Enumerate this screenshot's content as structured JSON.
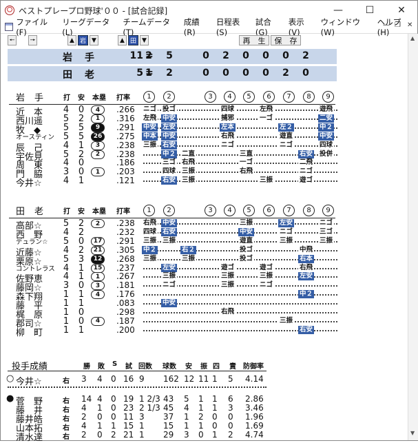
{
  "window": {
    "title": "ベストプレープロ野球'００ - [試合記録]"
  },
  "menu": [
    "ファイル(F)",
    "リーグデータ(L)",
    "チームデータ(T)",
    "成績(R)",
    "日程表(S)",
    "試合(G)",
    "表示(V)",
    "ウィンドウ(W)",
    "ヘルプ(H)"
  ],
  "toolbar": {
    "team1": "岩",
    "team2": "田",
    "play": "再　生",
    "save": "保　存"
  },
  "innings": [
    "1",
    "2",
    "3",
    "4",
    "5",
    "6",
    "7",
    "8",
    "9"
  ],
  "scoreboard": [
    {
      "team": "岩手",
      "total": "11",
      "eq": "=",
      "inn": [
        "2",
        "5",
        "",
        "0",
        "2",
        "0",
        "0",
        "0",
        "2"
      ]
    },
    {
      "team": "田老",
      "total": "5",
      "eq": "=",
      "inn": [
        "1",
        "2",
        "",
        "0",
        "0",
        "0",
        "0",
        "2",
        "0"
      ]
    }
  ],
  "batting_headers": {
    "ab": "打",
    "h": "安",
    "hr": "本塁",
    "avg": "打率"
  },
  "teams": [
    {
      "name": "岩手",
      "players": [
        {
          "name": "近　本",
          "ab": "4",
          "h": "0",
          "hr": "4",
          "black": false,
          "avg": ".266",
          "results": [
            [
              "1",
              "ニゴ",
              false
            ],
            [
              "2",
              "投ゴ",
              false
            ],
            [
              "4",
              "四球",
              false
            ],
            [
              "6",
              "左飛",
              false
            ],
            [
              "9",
              "遊飛",
              false
            ]
          ]
        },
        {
          "name": "西川遥",
          "ab": "5",
          "h": "2",
          "hr": "1",
          "black": false,
          "avg": ".316",
          "results": [
            [
              "1",
              "左飛",
              false
            ],
            [
              "2",
              "中安",
              true
            ],
            [
              "4",
              "捕邪",
              false
            ],
            [
              "6",
              "一ゴ",
              false
            ],
            [
              "9",
              "二安",
              true
            ]
          ]
        },
        {
          "name": "牧　◆",
          "ab": "5",
          "h": "5",
          "hr": "9",
          "black": true,
          "avg": ".291",
          "results": [
            [
              "1",
              "中安",
              true
            ],
            [
              "2",
              "左安",
              true
            ],
            [
              "4",
              "左本",
              true
            ],
            [
              "7",
              "左２",
              true
            ],
            [
              "9",
              "中２",
              true
            ]
          ]
        },
        {
          "name": "オースティン",
          "ab": "5",
          "h": "5",
          "hr": "26",
          "black": true,
          "small": true,
          "avg": ".275",
          "results": [
            [
              "1",
              "中本",
              true
            ],
            [
              "2",
              "中安",
              true
            ],
            [
              "4",
              "右飛",
              false
            ],
            [
              "7",
              "遊直",
              false
            ],
            [
              "9",
              "中安",
              true
            ]
          ]
        },
        {
          "name": "辰　己",
          "ab": "4",
          "h": "1",
          "hr": "3",
          "black": false,
          "avg": ".238",
          "results": [
            [
              "1",
              "三振",
              false
            ],
            [
              "2",
              "右安",
              true
            ],
            [
              "4",
              "ニゴ",
              false
            ],
            [
              "7",
              "ニゴ",
              false
            ],
            [
              "9",
              "四球",
              false
            ]
          ]
        },
        {
          "name": "宇佐見",
          "ab": "5",
          "h": "2",
          "hr": "2",
          "black": false,
          "avg": ".238",
          "results": [
            [
              "2",
              "中２",
              true
            ],
            [
              "3",
              "二直",
              false
            ],
            [
              "5",
              "三直",
              false
            ],
            [
              "8",
              "右安",
              true
            ],
            [
              "9",
              "投併",
              false
            ]
          ]
        },
        {
          "name": "周　東",
          "ab": "4",
          "h": "0",
          "hr": "",
          "black": false,
          "avg": ".186",
          "results": [
            [
              "2",
              "三ゴ",
              false
            ],
            [
              "3",
              "右飛",
              false
            ],
            [
              "5",
              "一ゴ",
              false
            ],
            [
              "8",
              "二飛",
              false
            ]
          ]
        },
        {
          "name": "門　脇",
          "ab": "3",
          "h": "0",
          "hr": "1",
          "black": false,
          "avg": ".203",
          "results": [
            [
              "2",
              "四球",
              false
            ],
            [
              "3",
              "三振",
              false
            ],
            [
              "5",
              "右飛",
              false
            ],
            [
              "8",
              "ニゴ",
              false
            ]
          ]
        },
        {
          "name": "今井☆",
          "ab": "4",
          "h": "1",
          "hr": "",
          "black": false,
          "avg": ".121",
          "results": [
            [
              "2",
              "右安",
              true
            ],
            [
              "3",
              "三振",
              false
            ],
            [
              "6",
              "三振",
              false
            ],
            [
              "8",
              "遊ゴ",
              false
            ]
          ]
        }
      ]
    },
    {
      "name": "田老",
      "players": [
        {
          "name": "高部☆",
          "ab": "5",
          "h": "2",
          "hr": "2",
          "black": false,
          "avg": ".238",
          "results": [
            [
              "1",
              "右飛",
              false
            ],
            [
              "2",
              "中安",
              true
            ],
            [
              "5",
              "三振",
              false
            ],
            [
              "7",
              "左安",
              true
            ],
            [
              "9",
              "ニゴ",
              false
            ]
          ]
        },
        {
          "name": "西　野",
          "ab": "4",
          "h": "2",
          "hr": "",
          "black": false,
          "avg": ".232",
          "results": [
            [
              "1",
              "四球",
              false
            ],
            [
              "2",
              "右安",
              true
            ],
            [
              "5",
              "中安",
              true
            ],
            [
              "7",
              "ニゴ",
              false
            ],
            [
              "9",
              "三ゴ",
              false
            ]
          ]
        },
        {
          "name": "デュラン☆",
          "ab": "5",
          "h": "0",
          "hr": "17",
          "black": false,
          "small": true,
          "avg": ".291",
          "results": [
            [
              "1",
              "三振",
              false
            ],
            [
              "2",
              "三振",
              false
            ],
            [
              "5",
              "遊直",
              false
            ],
            [
              "7",
              "三振",
              false
            ],
            [
              "9",
              "三振",
              false
            ]
          ]
        },
        {
          "name": "近藤☆",
          "ab": "4",
          "h": "2",
          "hr": "21",
          "black": false,
          "avg": ".305",
          "results": [
            [
              "1",
              "中２",
              true
            ],
            [
              "3",
              "右２",
              true
            ],
            [
              "5",
              "投ゴ",
              false
            ],
            [
              "8",
              "中飛",
              false
            ]
          ]
        },
        {
          "name": "栗原☆",
          "ab": "5",
          "h": "3",
          "hr": "12",
          "black": true,
          "avg": ".268",
          "results": [
            [
              "1",
              "三振",
              false
            ],
            [
              "3",
              "三振",
              false
            ],
            [
              "5",
              "投ゴ",
              false
            ],
            [
              "8",
              "右本",
              true
            ]
          ]
        },
        {
          "name": "コントレラス",
          "ab": "4",
          "h": "1",
          "hr": "15",
          "black": false,
          "small": true,
          "avg": ".237",
          "results": [
            [
              "2",
              "左安",
              true
            ],
            [
              "4",
              "遊ゴ",
              false
            ],
            [
              "6",
              "遊ゴ",
              false
            ],
            [
              "8",
              "右飛",
              false
            ]
          ]
        },
        {
          "name": "佐野恵",
          "ab": "4",
          "h": "1",
          "hr": "1",
          "black": false,
          "avg": ".267",
          "results": [
            [
              "2",
              "三振",
              false
            ],
            [
              "4",
              "三振",
              false
            ],
            [
              "6",
              "三振",
              false
            ],
            [
              "8",
              "左安",
              true
            ]
          ]
        },
        {
          "name": "藤岡☆",
          "ab": "3",
          "h": "0",
          "hr": "3",
          "black": false,
          "avg": ".181",
          "results": [
            [
              "2",
              "ニゴ",
              false
            ],
            [
              "4",
              "三振",
              false
            ],
            [
              "6",
              "ニゴ",
              false
            ]
          ]
        },
        {
          "name": "森下翔",
          "ab": "1",
          "h": "1",
          "hr": "4",
          "black": false,
          "avg": ".176",
          "results": [
            [
              "8",
              "中２",
              true
            ]
          ]
        },
        {
          "name": "藤　平",
          "ab": "1",
          "h": "1",
          "hr": "",
          "black": false,
          "avg": ".083",
          "results": [
            [
              "2",
              "中安",
              true
            ]
          ]
        },
        {
          "name": "梶　原",
          "ab": "1",
          "h": "0",
          "hr": "",
          "black": false,
          "avg": ".298",
          "results": [
            [
              "4",
              "右飛",
              false
            ]
          ]
        },
        {
          "name": "郡司☆",
          "ab": "1",
          "h": "0",
          "hr": "4",
          "black": false,
          "avg": ".187",
          "results": [
            [
              "7",
              "三振",
              false
            ]
          ]
        },
        {
          "name": "柳　町",
          "ab": "1",
          "h": "1",
          "hr": "",
          "black": false,
          "avg": ".200",
          "results": [
            [
              "8",
              "右安",
              true
            ]
          ]
        }
      ]
    }
  ],
  "pitching": {
    "title": "投手成績",
    "headers": [
      "勝",
      "敗",
      "S",
      "試",
      "回数",
      "球数",
      "安",
      "振",
      "四",
      "責",
      "防御率"
    ],
    "rows": [
      {
        "mark": "○",
        "name": "今井☆",
        "hand": "右",
        "vals": [
          "3",
          "4",
          "0",
          "16",
          "9",
          "162",
          "12",
          "11",
          "1",
          "5",
          "4.14"
        ]
      },
      {
        "mark": "●",
        "name": "菅　野",
        "hand": "右",
        "vals": [
          "14",
          "4",
          "0",
          "19",
          "1 2/3",
          "43",
          "5",
          "1",
          "1",
          "6",
          "2.86"
        ]
      },
      {
        "mark": "",
        "name": "藤　井",
        "hand": "右",
        "vals": [
          "4",
          "1",
          "0",
          "23",
          "2 1/3",
          "45",
          "4",
          "1",
          "1",
          "3",
          "3.46"
        ]
      },
      {
        "mark": "",
        "name": "藤井皓",
        "hand": "右",
        "vals": [
          "2",
          "0",
          "0",
          "11",
          "3",
          "37",
          "1",
          "2",
          "0",
          "0",
          "1.96"
        ]
      },
      {
        "mark": "",
        "name": "山本拓",
        "hand": "右",
        "vals": [
          "4",
          "1",
          "1",
          "15",
          "1",
          "15",
          "1",
          "1",
          "0",
          "0",
          "1.69"
        ]
      },
      {
        "mark": "",
        "name": "清水達",
        "hand": "右",
        "vals": [
          "2",
          "0",
          "2",
          "21",
          "1",
          "29",
          "3",
          "0",
          "1",
          "2",
          "4.74"
        ]
      }
    ]
  }
}
